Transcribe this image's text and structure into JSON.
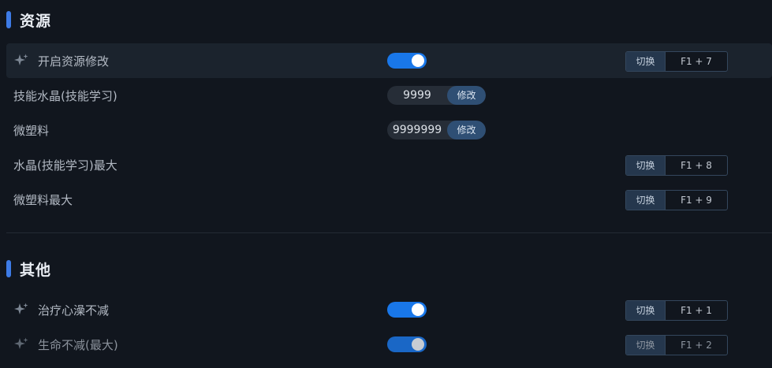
{
  "sections": [
    {
      "title": "资源",
      "rows": [
        {
          "label": "开启资源修改",
          "hotkey_button": "切换",
          "hotkey": "F1 + 7"
        },
        {
          "label": "技能水晶(技能学习)",
          "value": "9999",
          "button": "修改"
        },
        {
          "label": "微塑料",
          "value": "9999999",
          "button": "修改"
        },
        {
          "label": "水晶(技能学习)最大",
          "hotkey_button": "切换",
          "hotkey": "F1 + 8"
        },
        {
          "label": "微塑料最大",
          "hotkey_button": "切换",
          "hotkey": "F1 + 9"
        }
      ]
    },
    {
      "title": "其他",
      "rows": [
        {
          "label": "治疗心澡不减",
          "hotkey_button": "切换",
          "hotkey": "F1 + 1"
        },
        {
          "label": "生命不减(最大)",
          "hotkey_button": "切换",
          "hotkey": "F1 + 2"
        }
      ]
    }
  ],
  "toggles": {
    "resource_mod": true,
    "heal_no_decrease": true,
    "life_no_decrease": true
  },
  "colors": {
    "accent": "#3d7be6",
    "toggle_on": "#1977e9",
    "background": "#11161e"
  },
  "icons": {
    "sparkle": "sparkle-icon"
  }
}
